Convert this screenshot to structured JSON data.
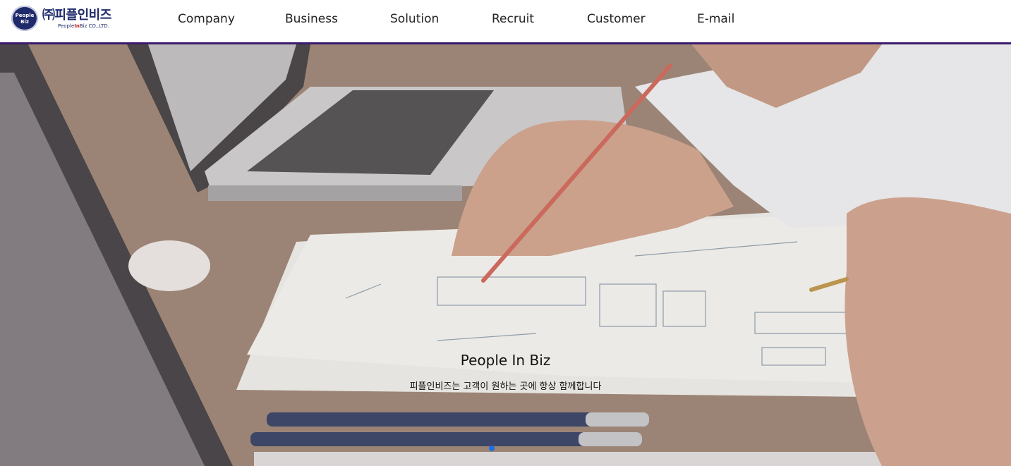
{
  "header": {
    "logo": {
      "korean_name": "㈜피플인비즈",
      "badge_line1": "People",
      "badge_line2": "Biz",
      "en_prefix": "People",
      "en_highlight": "In",
      "en_suffix": "Biz  CO.,LTD."
    },
    "nav": [
      "Company",
      "Business",
      "Solution",
      "Recruit",
      "Customer",
      "E-mail"
    ]
  },
  "hero": {
    "title": "People In Biz",
    "subtitle": "피플인비즈는 고객이 원하는 곳에 항상 함께합니다"
  },
  "colors": {
    "brand_navy": "#1f2a6b",
    "header_line": "#3a1a6e",
    "active_dot": "#1d6fe0"
  }
}
